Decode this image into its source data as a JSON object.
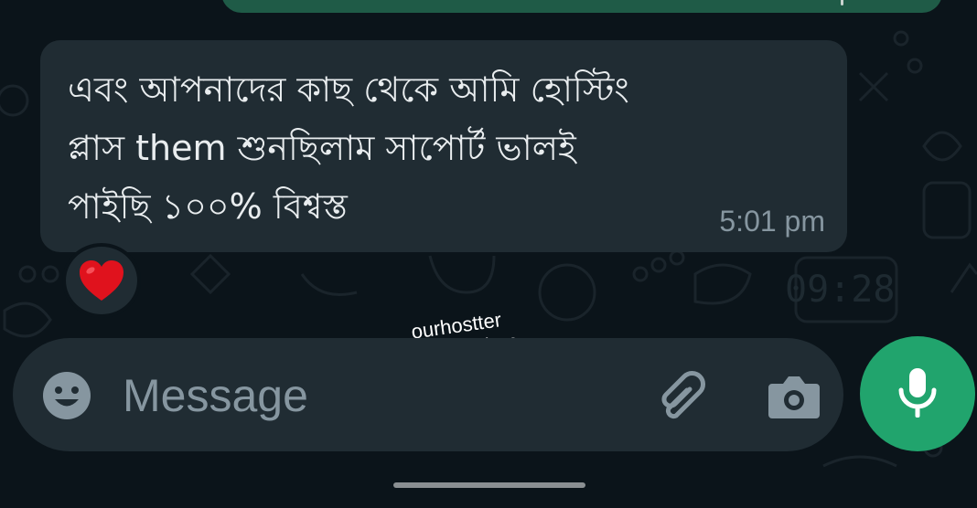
{
  "message": {
    "lines": [
      "এবং আপনাদের কাছ থেকে আমি হোস্টিং",
      "প্লাস them শুনছিলাম সাপোর্ট ভালই",
      "পাইছি ১০০% বিশ্বস্ত"
    ],
    "time": "5:01 pm",
    "reaction": "red-heart"
  },
  "watermark": {
    "line1": "ourhostter",
    "line2": "goriberdokan"
  },
  "composer": {
    "placeholder": "Message"
  },
  "icons": {
    "emoji": "emoji-icon",
    "attach": "paperclip-icon",
    "camera": "camera-icon",
    "mic": "microphone-icon",
    "heart": "heart-icon"
  },
  "colors": {
    "background": "#0b141a",
    "bubble": "#202c33",
    "outgoing_bubble": "#1f5b47",
    "accent_green": "#21a46d",
    "heart": "#e0121d",
    "secondary_text": "#8696a0"
  }
}
